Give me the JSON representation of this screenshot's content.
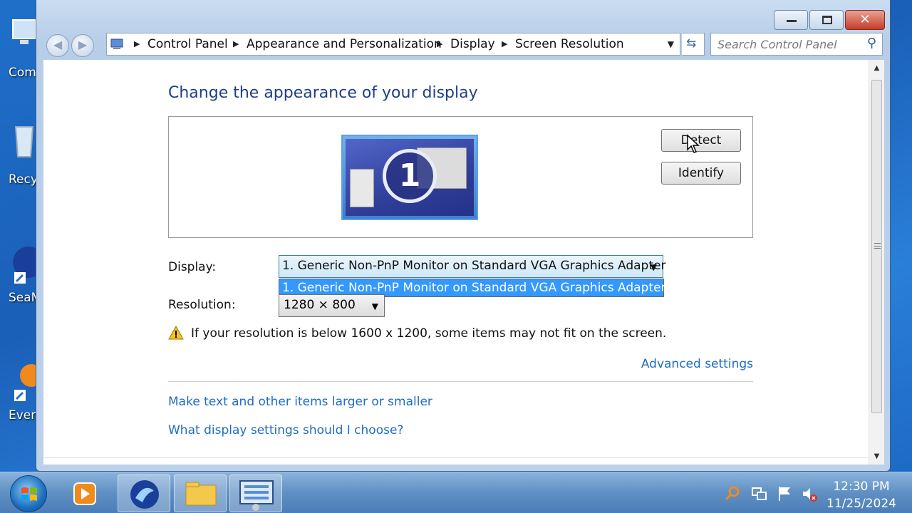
{
  "desktop": {
    "icons": [
      {
        "label": "Com"
      },
      {
        "label": "Recy"
      },
      {
        "label": "SeaM"
      },
      {
        "label": "Every"
      }
    ]
  },
  "window": {
    "address": {
      "crumbs": [
        "Control Panel",
        "Appearance and Personalization",
        "Display",
        "Screen Resolution"
      ]
    },
    "search": {
      "placeholder": "Search Control Panel"
    },
    "buttons": {
      "minimize": "minimize-icon",
      "maximize": "maximize-icon",
      "close": "✕"
    }
  },
  "content": {
    "heading": "Change the appearance of your display",
    "monitor_number": "1",
    "detect_label": "Detect",
    "identify_label": "Identify",
    "display_label": "Display:",
    "display_value": "1. Generic Non-PnP Monitor on Standard VGA Graphics Adapter",
    "display_options": [
      "1. Generic Non-PnP Monitor on Standard VGA Graphics Adapter"
    ],
    "resolution_label": "Resolution:",
    "resolution_value": "1280 × 800",
    "warning_text": "If your resolution is below 1600 x 1200, some items may not fit on the screen.",
    "advanced_link": "Advanced settings",
    "link_text_size": "Make text and other items larger or smaller",
    "link_which_settings": "What display settings should I choose?"
  },
  "taskbar": {
    "apps": [
      "media-player-icon",
      "seamonkey-icon",
      "file-explorer-icon",
      "control-panel-icon"
    ],
    "clock": {
      "time": "12:30 PM",
      "date": "11/25/2024"
    }
  },
  "colors": {
    "accent_link": "#1e6dc0",
    "heading": "#1e3f87",
    "selection": "#3399ff"
  }
}
